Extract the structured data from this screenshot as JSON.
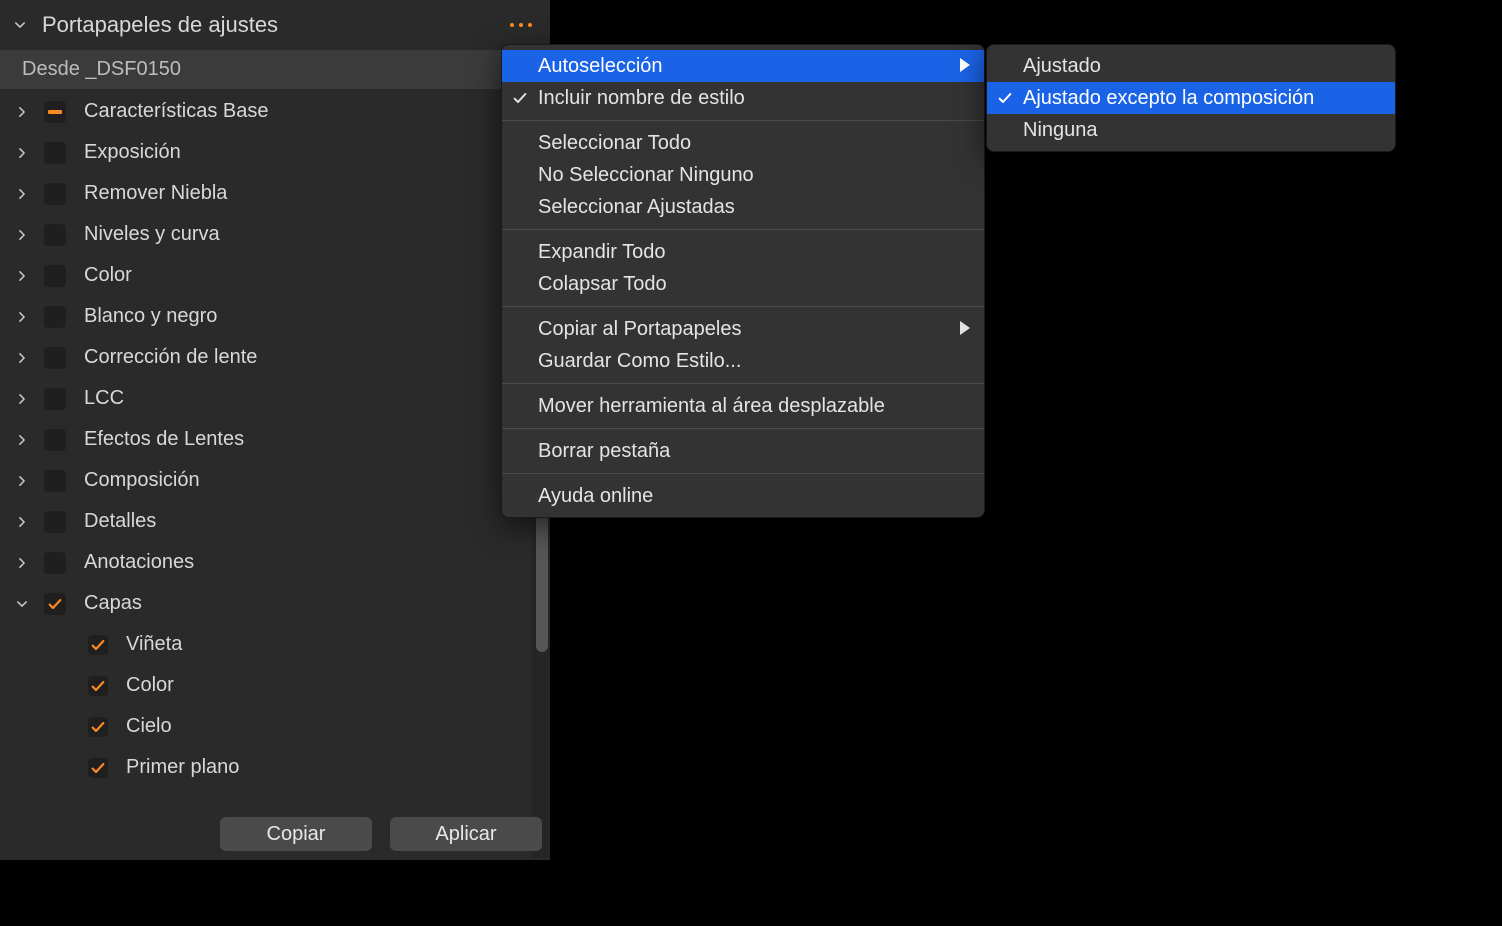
{
  "panel": {
    "title": "Portapapeles de ajustes",
    "from_label": "Desde _DSF0150",
    "rows": [
      {
        "label": "Características Base",
        "state": "indeterminate",
        "expandable": true,
        "expanded": false,
        "sub": false
      },
      {
        "label": "Exposición",
        "state": "unchecked",
        "expandable": true,
        "expanded": false,
        "sub": false
      },
      {
        "label": "Remover Niebla",
        "state": "unchecked",
        "expandable": true,
        "expanded": false,
        "sub": false
      },
      {
        "label": "Niveles y curva",
        "state": "unchecked",
        "expandable": true,
        "expanded": false,
        "sub": false
      },
      {
        "label": "Color",
        "state": "unchecked",
        "expandable": true,
        "expanded": false,
        "sub": false
      },
      {
        "label": "Blanco y negro",
        "state": "unchecked",
        "expandable": true,
        "expanded": false,
        "sub": false
      },
      {
        "label": "Corrección de lente",
        "state": "unchecked",
        "expandable": true,
        "expanded": false,
        "sub": false
      },
      {
        "label": "LCC",
        "state": "unchecked",
        "expandable": true,
        "expanded": false,
        "sub": false
      },
      {
        "label": "Efectos de Lentes",
        "state": "unchecked",
        "expandable": true,
        "expanded": false,
        "sub": false
      },
      {
        "label": "Composición",
        "state": "unchecked",
        "expandable": true,
        "expanded": false,
        "sub": false
      },
      {
        "label": "Detalles",
        "state": "unchecked",
        "expandable": true,
        "expanded": false,
        "sub": false
      },
      {
        "label": "Anotaciones",
        "state": "unchecked",
        "expandable": true,
        "expanded": false,
        "sub": false
      },
      {
        "label": "Capas",
        "state": "checked",
        "expandable": true,
        "expanded": true,
        "sub": false
      },
      {
        "label": "Viñeta",
        "state": "checked",
        "expandable": false,
        "expanded": false,
        "sub": true
      },
      {
        "label": "Color",
        "state": "checked",
        "expandable": false,
        "expanded": false,
        "sub": true
      },
      {
        "label": "Cielo",
        "state": "checked",
        "expandable": false,
        "expanded": false,
        "sub": true
      },
      {
        "label": "Primer plano",
        "state": "checked",
        "expandable": false,
        "expanded": false,
        "sub": true
      }
    ],
    "footer": {
      "copy": "Copiar",
      "apply": "Aplicar"
    }
  },
  "menu": {
    "groups": [
      [
        {
          "label": "Autoselección",
          "highlighted": true,
          "checked": false,
          "submenu": true
        },
        {
          "label": "Incluir nombre de estilo",
          "highlighted": false,
          "checked": true,
          "submenu": false
        }
      ],
      [
        {
          "label": "Seleccionar Todo",
          "highlighted": false,
          "checked": false,
          "submenu": false
        },
        {
          "label": "No Seleccionar Ninguno",
          "highlighted": false,
          "checked": false,
          "submenu": false
        },
        {
          "label": "Seleccionar Ajustadas",
          "highlighted": false,
          "checked": false,
          "submenu": false
        }
      ],
      [
        {
          "label": "Expandir Todo",
          "highlighted": false,
          "checked": false,
          "submenu": false
        },
        {
          "label": "Colapsar Todo",
          "highlighted": false,
          "checked": false,
          "submenu": false
        }
      ],
      [
        {
          "label": "Copiar al Portapapeles",
          "highlighted": false,
          "checked": false,
          "submenu": true
        },
        {
          "label": "Guardar Como Estilo...",
          "highlighted": false,
          "checked": false,
          "submenu": false
        }
      ],
      [
        {
          "label": "Mover herramienta al área desplazable",
          "highlighted": false,
          "checked": false,
          "submenu": false
        }
      ],
      [
        {
          "label": "Borrar pestaña",
          "highlighted": false,
          "checked": false,
          "submenu": false
        }
      ],
      [
        {
          "label": "Ayuda online",
          "highlighted": false,
          "checked": false,
          "submenu": false
        }
      ]
    ]
  },
  "submenu": {
    "items": [
      {
        "label": "Ajustado",
        "highlighted": false,
        "checked": false
      },
      {
        "label": "Ajustado excepto la composición",
        "highlighted": true,
        "checked": true
      },
      {
        "label": "Ninguna",
        "highlighted": false,
        "checked": false
      }
    ]
  }
}
